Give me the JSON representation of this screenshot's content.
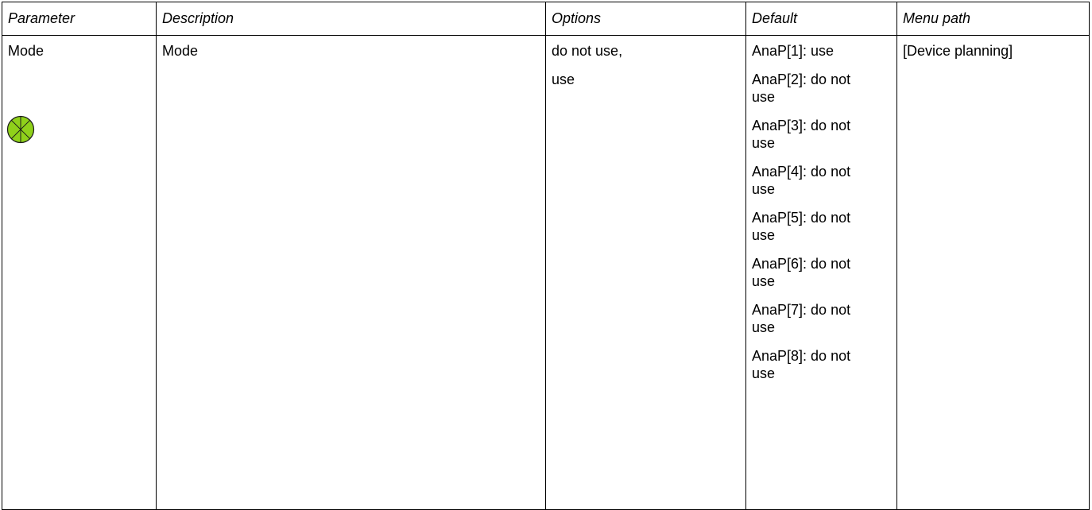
{
  "headers": {
    "parameter": "Parameter",
    "description": "Description",
    "options": "Options",
    "default": "Default",
    "menu_path": "Menu path"
  },
  "row": {
    "parameter": "Mode",
    "description": "Mode",
    "options": [
      "do not use,",
      "use"
    ],
    "defaults": [
      "AnaP[1]: use",
      "AnaP[2]: do not use",
      "AnaP[3]: do not use",
      "AnaP[4]: do not use",
      "AnaP[5]: do not use",
      "AnaP[6]: do not use",
      "AnaP[7]: do not use",
      "AnaP[8]: do not use"
    ],
    "menu_path": "[Device planning]",
    "icon": "device-planning-icon"
  },
  "colors": {
    "icon_fill": "#8fd11a",
    "border": "#000000"
  }
}
